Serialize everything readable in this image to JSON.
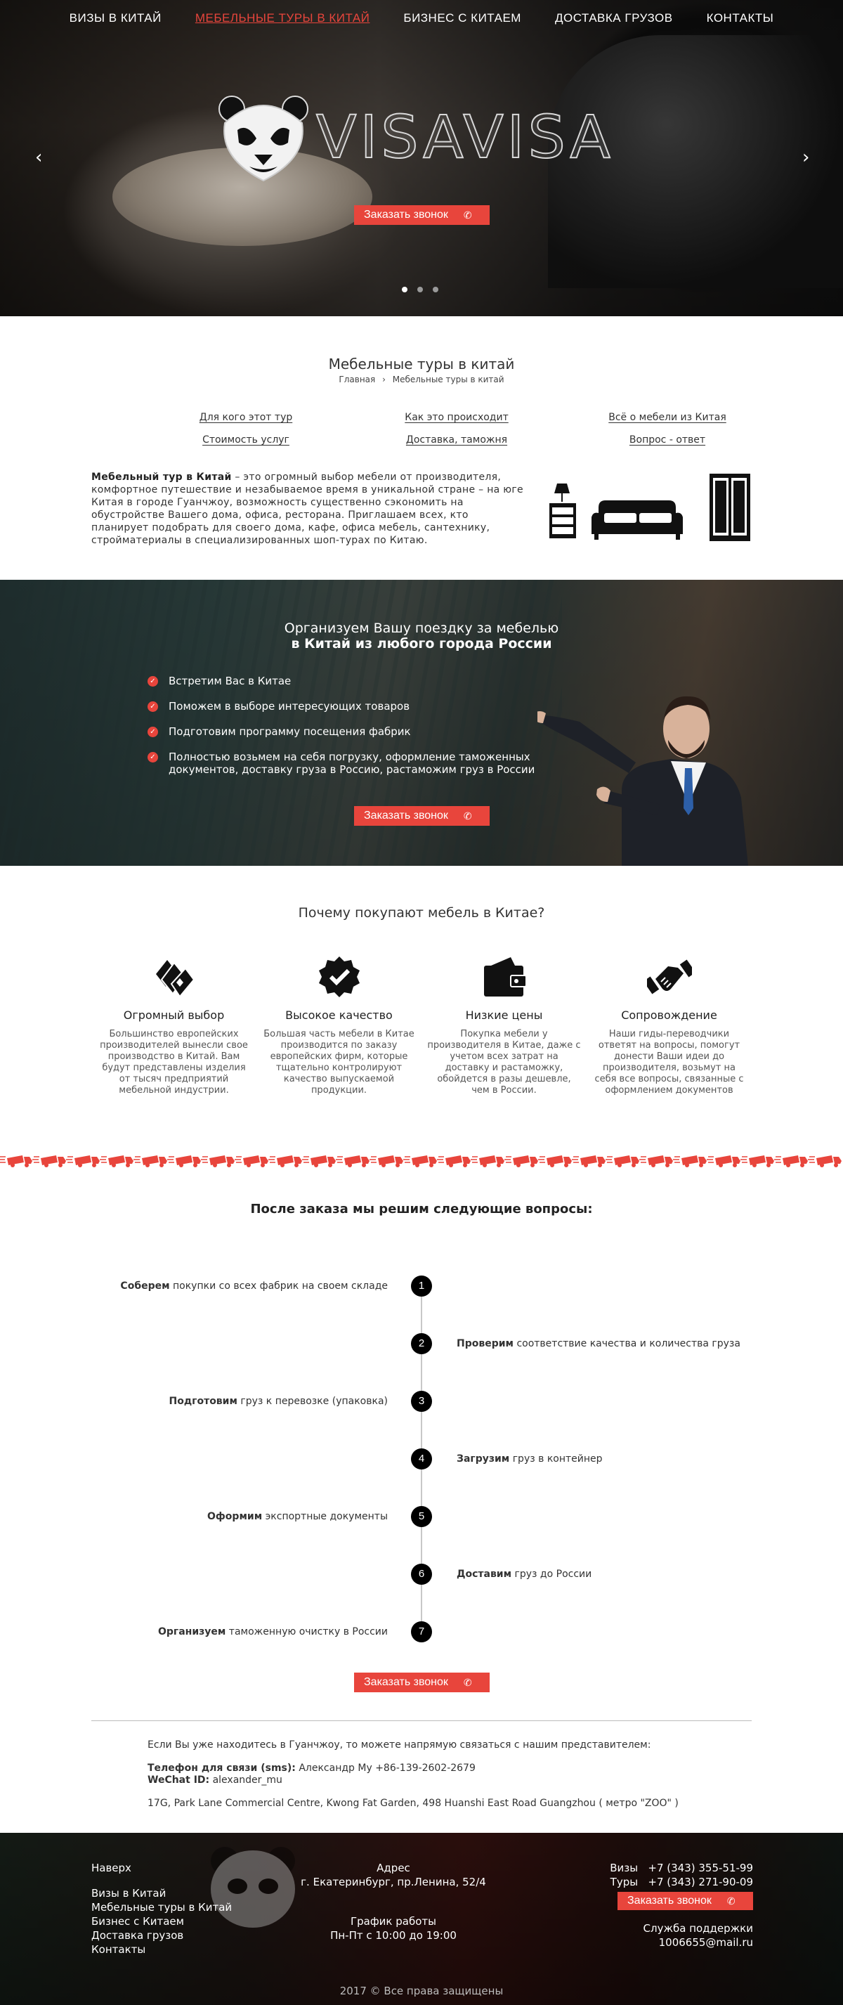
{
  "nav": [
    {
      "label": "Визы в Китай",
      "active": false
    },
    {
      "label": "Мебельные туры в Китай",
      "active": true
    },
    {
      "label": "Бизнес с Китаем",
      "active": false
    },
    {
      "label": "Доставка грузов",
      "active": false
    },
    {
      "label": "Контакты",
      "active": false
    }
  ],
  "hero": {
    "logo_text": "VISAVISA",
    "cta": "Заказать звонок",
    "slides": 3,
    "active_slide": 1
  },
  "intro_section": {
    "title": "Мебельные туры в китай",
    "breadcrumb_home": "Главная",
    "breadcrumb_sep": "›",
    "breadcrumb_current": "Мебельные туры в китай",
    "links": [
      "Для кого этот тур",
      "Как это происходит",
      "Всё о мебели из Китая",
      "Стоимость услуг",
      "Доставка, таможня",
      "Вопрос - ответ"
    ],
    "text_bold": "Мебельный тур в Китай",
    "text": " – это огромный выбор мебели от производителя, комфортное путешествие и незабываемое время в уникальной стране – на юге Китая в городе Гуанчжоу, возможность существенно сэкономить на обустройстве Вашего дома, офиса, ресторана. Приглашаем всех, кто планирует подобрать для своего дома, кафе, офиса мебель, сантехнику, стройматериалы в специализированных шоп-турах по Китаю."
  },
  "trip_section": {
    "heading_line1": "Организуем Вашу поездку за мебелью",
    "heading_line2": "в Китай из любого города России",
    "items": [
      "Встретим Вас в Китае",
      "Поможем в выборе интересующих товаров",
      "Подготовим программу посещения фабрик",
      "Полностью возьмем на себя погрузку, оформление таможенных документов, доставку груза в Россию, растаможим груз в России"
    ],
    "cta": "Заказать звонок"
  },
  "why_section": {
    "title": "Почему покупают мебель в Китае?",
    "features": [
      {
        "icon": "fan-of-cards-icon",
        "title": "Огромный выбор",
        "text": "Большинство европейских производителей вынесли свое производство в Китай. Вам будут представлены изделия от тысяч предприятий мебельной индустрии."
      },
      {
        "icon": "quality-badge-icon",
        "title": "Высокое качество",
        "text": "Большая часть мебели в Китае производится по заказу европейских фирм, которые тщательно контролируют качество выпускаемой продукции."
      },
      {
        "icon": "wallet-icon",
        "title": "Низкие цены",
        "text": "Покупка мебели у производителя в Китае, даже с учетом всех затрат на доставку и растаможку, обойдется в разы дешевле, чем в России."
      },
      {
        "icon": "handshake-icon",
        "title": "Сопровождение",
        "text": "Наши гиды-переводчики ответят на вопросы, помогут донести Ваши идеи до производителя, возьмут на себя все вопросы, связанные с оформлением документов"
      }
    ]
  },
  "steps_section": {
    "title": "После заказа мы решим следующие вопросы:",
    "steps": [
      {
        "num": "1",
        "bold": "Соберем",
        "text": " покупки со всех фабрик на своем складе",
        "side": "left",
        "badge": false
      },
      {
        "num": "2",
        "bold": "Проверим",
        "text": " соответствие качества и количества груза",
        "side": "right",
        "badge": true
      },
      {
        "num": "3",
        "bold": "Подготовим",
        "text": " груз к перевозке (упаковка)",
        "side": "left",
        "badge": false
      },
      {
        "num": "4",
        "bold": "Загрузим",
        "text": " груз в контейнер",
        "side": "right",
        "badge": true
      },
      {
        "num": "5",
        "bold": "Оформим",
        "text": " экспортные документы",
        "side": "left",
        "badge": false
      },
      {
        "num": "6",
        "bold": "Доставим",
        "text": " груз до России",
        "side": "right",
        "badge": false
      },
      {
        "num": "7",
        "bold": "Организуем",
        "text": " таможенную очистку в России",
        "side": "left",
        "badge": false
      }
    ],
    "cta": "Заказать звонок"
  },
  "contact": {
    "intro": "Если Вы уже находитесь в Гуанчжоу, то можете напрямую связаться с нашим представителем:",
    "phone_label": "Телефон для связи (sms):",
    "phone_value": "  Александр Му +86-139-2602-2679",
    "wechat_label": "WeChat ID:",
    "wechat_value": " alexander_mu",
    "address": "17G, Park Lane Commercial Centre, Kwong Fat Garden, 498 Huanshi East Road Guangzhou ( метро \"ZOO\" )"
  },
  "footer": {
    "top_link": "Наверх",
    "links": [
      "Визы в Китай",
      "Мебельные туры в Китай",
      "Бизнес с Китаем",
      "Доставка грузов",
      "Контакты"
    ],
    "address_label": "Адрес",
    "address": "г. Екатеринбург, пр.Ленина, 52/4",
    "hours_label": "График работы",
    "hours": "Пн-Пт с 10:00 до 19:00",
    "visa_label": "Визы",
    "visa_phone": "+7 (343) 355-51-99",
    "tours_label": "Туры",
    "tours_phone": "+7 (343) 271-90-09",
    "cta": "Заказать звонок",
    "support_label": "Служба поддержки",
    "support_email": "1006655@mail.ru",
    "copyright": "2017 © Все права защищены"
  }
}
